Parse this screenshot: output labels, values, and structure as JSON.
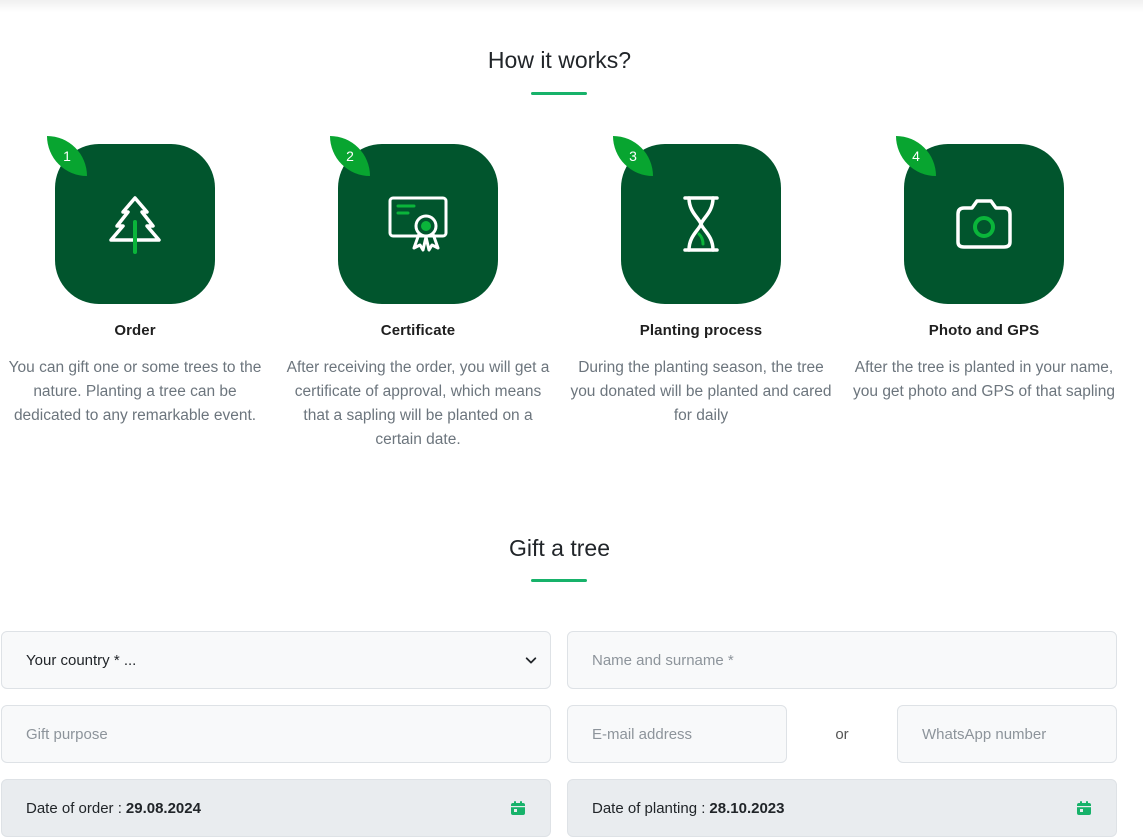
{
  "how": {
    "title": "How it works?",
    "steps": [
      {
        "num": "1",
        "title": "Order",
        "icon": "tree-icon",
        "desc": "You can gift one or some trees to the nature. Planting a tree can be dedicated to any remarkable event."
      },
      {
        "num": "2",
        "title": "Certificate",
        "icon": "certificate-icon",
        "desc": "After receiving the order, you will get a certificate of approval, which means that a sapling will be planted on a certain date."
      },
      {
        "num": "3",
        "title": "Planting process",
        "icon": "hourglass-icon",
        "desc": "During the planting season, the tree you donated will be planted and cared for daily"
      },
      {
        "num": "4",
        "title": "Photo and GPS",
        "icon": "camera-icon",
        "desc": "After the tree is planted in your name, you get photo and GPS of that sapling"
      }
    ]
  },
  "gift": {
    "title": "Gift a tree",
    "country_select": "Your country * ...",
    "name_placeholder": "Name and surname *",
    "purpose_placeholder": "Gift purpose",
    "email_placeholder": "E-mail address",
    "or_text": "or",
    "whatsapp_placeholder": "WhatsApp number",
    "order_date_label": "Date of order :",
    "order_date_value": "29.08.2024",
    "planting_date_label": "Date of planting :",
    "planting_date_value": "28.10.2023"
  },
  "colors": {
    "tile": "#01552d",
    "badge": "#08a530",
    "accent": "#17b26a"
  }
}
